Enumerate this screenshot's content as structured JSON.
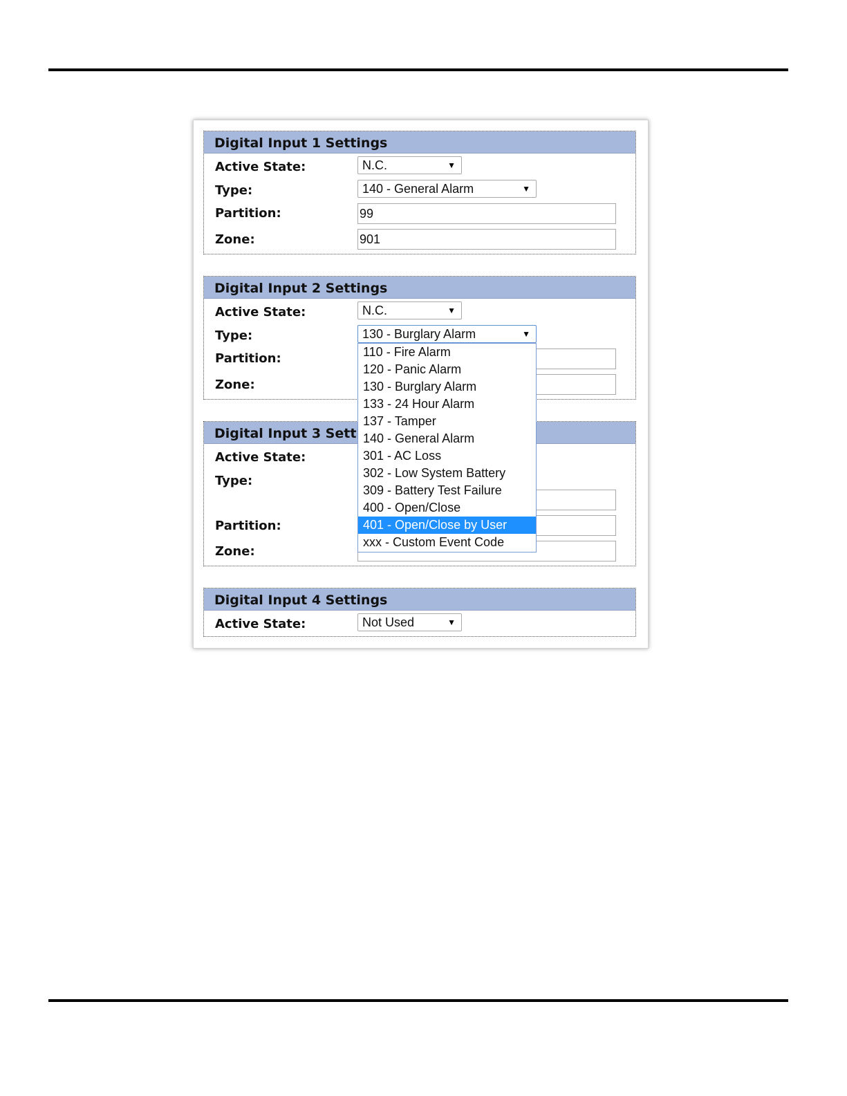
{
  "sections": [
    {
      "title": "Digital Input 1 Settings",
      "active_state_label": "Active State:",
      "active_state_value": "N.C.",
      "type_label": "Type:",
      "type_value": "140 - General Alarm",
      "partition_label": "Partition:",
      "partition_value": "99",
      "zone_label": "Zone:",
      "zone_value": "901"
    },
    {
      "title": "Digital Input 2 Settings",
      "active_state_label": "Active State:",
      "active_state_value": "N.C.",
      "type_label": "Type:",
      "type_value": "130 - Burglary Alarm",
      "partition_label": "Partition:",
      "zone_label": "Zone:"
    },
    {
      "title": "Digital Input 3 Settings",
      "active_state_label": "Active State:",
      "type_label": "Type:",
      "partition_label": "Partition:",
      "zone_label": "Zone:"
    },
    {
      "title": "Digital Input 4 Settings",
      "active_state_label": "Active State:",
      "active_state_value": "Not Used"
    }
  ],
  "type_dropdown": {
    "options": [
      "110 - Fire Alarm",
      "120 - Panic Alarm",
      "130 - Burglary Alarm",
      "133 - 24 Hour Alarm",
      "137 - Tamper",
      "140 - General Alarm",
      "301 - AC Loss",
      "302 - Low System Battery",
      "309 - Battery Test Failure",
      "400 - Open/Close",
      "401 - Open/Close by User",
      "xxx - Custom Event Code"
    ],
    "highlighted": "401 - Open/Close by User"
  },
  "icons": {
    "dropdown_arrow": "▼"
  },
  "colors": {
    "header_background": "#a7b8dd",
    "option_highlight": "#1e90ff"
  }
}
